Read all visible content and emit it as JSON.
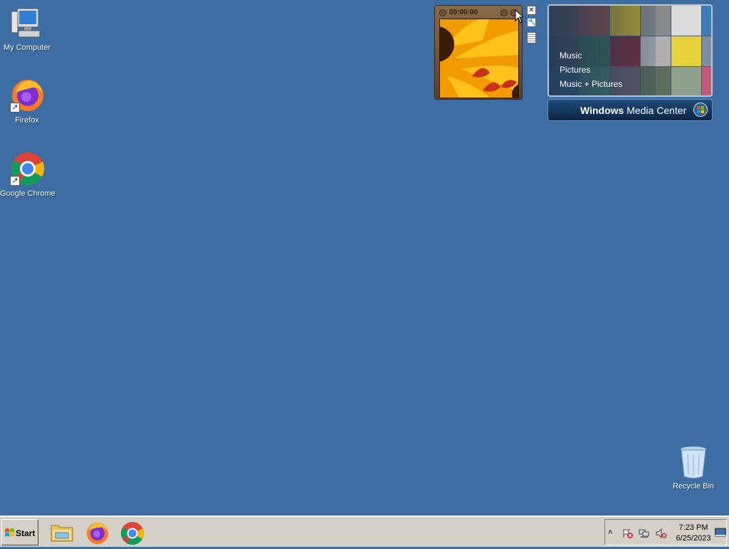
{
  "desktop": {
    "icons": [
      {
        "label": "My Computer",
        "icon": "computer-icon"
      },
      {
        "label": "Firefox",
        "icon": "firefox-icon"
      },
      {
        "label": "Google Chrome",
        "icon": "chrome-icon"
      },
      {
        "label": "Recycle Bin",
        "icon": "recycle-bin-icon"
      }
    ]
  },
  "slideshow_gadget": {
    "time": "00:00:00"
  },
  "media_center_gadget": {
    "menu": [
      "Music",
      "Pictures",
      "Music + Pictures"
    ],
    "bar_title_bold": "Windows",
    "bar_title_rest": " Media Center"
  },
  "taskbar": {
    "start_label": "Start",
    "pinned": [
      "file-explorer-icon",
      "firefox-icon",
      "chrome-icon"
    ],
    "clock_time": "7:23 PM",
    "clock_date": "6/25/2023"
  },
  "colors": {
    "desktop_bg": "#3d6ea3",
    "taskbar_bg": "#d4d0c8"
  }
}
